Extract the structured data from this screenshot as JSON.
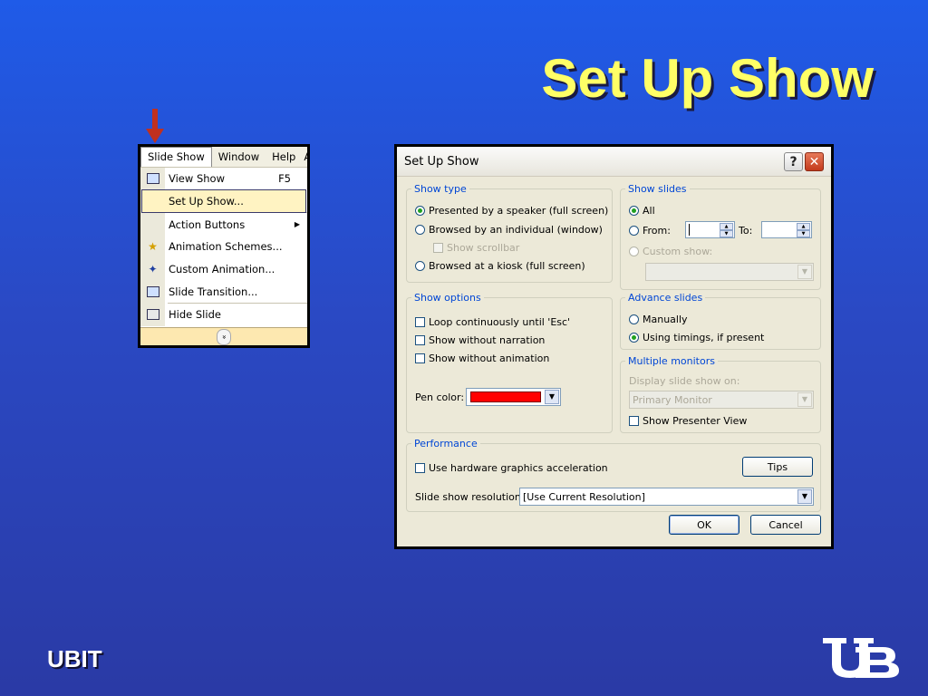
{
  "slide": {
    "title": "Set Up Show",
    "footer": "UBIT"
  },
  "menu": {
    "bar": [
      "Slide Show",
      "Window",
      "Help",
      "A"
    ],
    "items": [
      {
        "label": "View Show",
        "shortcut": "F5",
        "icon": "projector-icon"
      },
      {
        "label": "Set Up Show...",
        "shortcut": "",
        "icon": ""
      },
      {
        "label": "Action Buttons",
        "shortcut": "",
        "icon": "",
        "submenu": true
      },
      {
        "label": "Animation Schemes...",
        "shortcut": "",
        "icon": "star-icon"
      },
      {
        "label": "Custom Animation...",
        "shortcut": "",
        "icon": "custom-animation-icon"
      },
      {
        "label": "Slide Transition...",
        "shortcut": "",
        "icon": "transition-icon"
      },
      {
        "label": "Hide Slide",
        "shortcut": "",
        "icon": "hide-slide-icon"
      }
    ],
    "more_glyph": "»"
  },
  "dialog": {
    "title": "Set Up Show",
    "help_glyph": "?",
    "close_glyph": "✕",
    "show_type": {
      "legend": "Show type",
      "options": [
        "Presented by a speaker (full screen)",
        "Browsed by an individual (window)",
        "Browsed at a kiosk (full screen)"
      ],
      "selected": 0,
      "show_scrollbar": "Show scrollbar"
    },
    "show_slides": {
      "legend": "Show slides",
      "all": "All",
      "from": "From:",
      "to": "To:",
      "custom_show": "Custom show:"
    },
    "show_options": {
      "legend": "Show options",
      "loop": "Loop continuously until 'Esc'",
      "no_narration": "Show without narration",
      "no_animation": "Show without animation",
      "pen_color": "Pen color:",
      "pen_color_value": "#ff0000"
    },
    "advance_slides": {
      "legend": "Advance slides",
      "manually": "Manually",
      "timings": "Using timings, if present",
      "selected": 1
    },
    "multiple_monitors": {
      "legend": "Multiple monitors",
      "display_on": "Display slide show on:",
      "monitor_value": "Primary Monitor",
      "presenter_view": "Show Presenter View"
    },
    "performance": {
      "legend": "Performance",
      "hw_accel": "Use hardware graphics acceleration",
      "tips": "Tips",
      "resolution_label": "Slide show resolution:",
      "resolution_value": "[Use Current Resolution]"
    },
    "ok": "OK",
    "cancel": "Cancel"
  }
}
